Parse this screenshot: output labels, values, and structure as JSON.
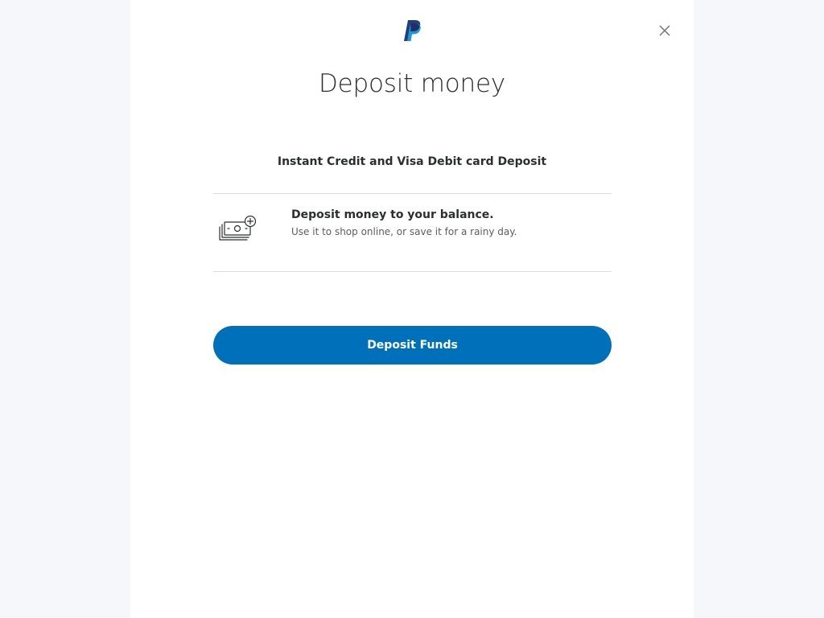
{
  "header": {
    "logo_icon": "paypal-logo-icon",
    "close_icon": "close-icon"
  },
  "title": "Deposit money",
  "section": {
    "heading": "Instant Credit and Visa Debit card Deposit"
  },
  "option": {
    "icon": "cash-plus-icon",
    "title": "Deposit money to your balance.",
    "description": "Use it to shop online, or save it for a rainy day."
  },
  "actions": {
    "deposit_label": "Deposit Funds"
  },
  "colors": {
    "primary": "#0070ba",
    "logo_dark": "#253b80",
    "logo_light": "#179bd7",
    "background": "#f5f7fa"
  }
}
